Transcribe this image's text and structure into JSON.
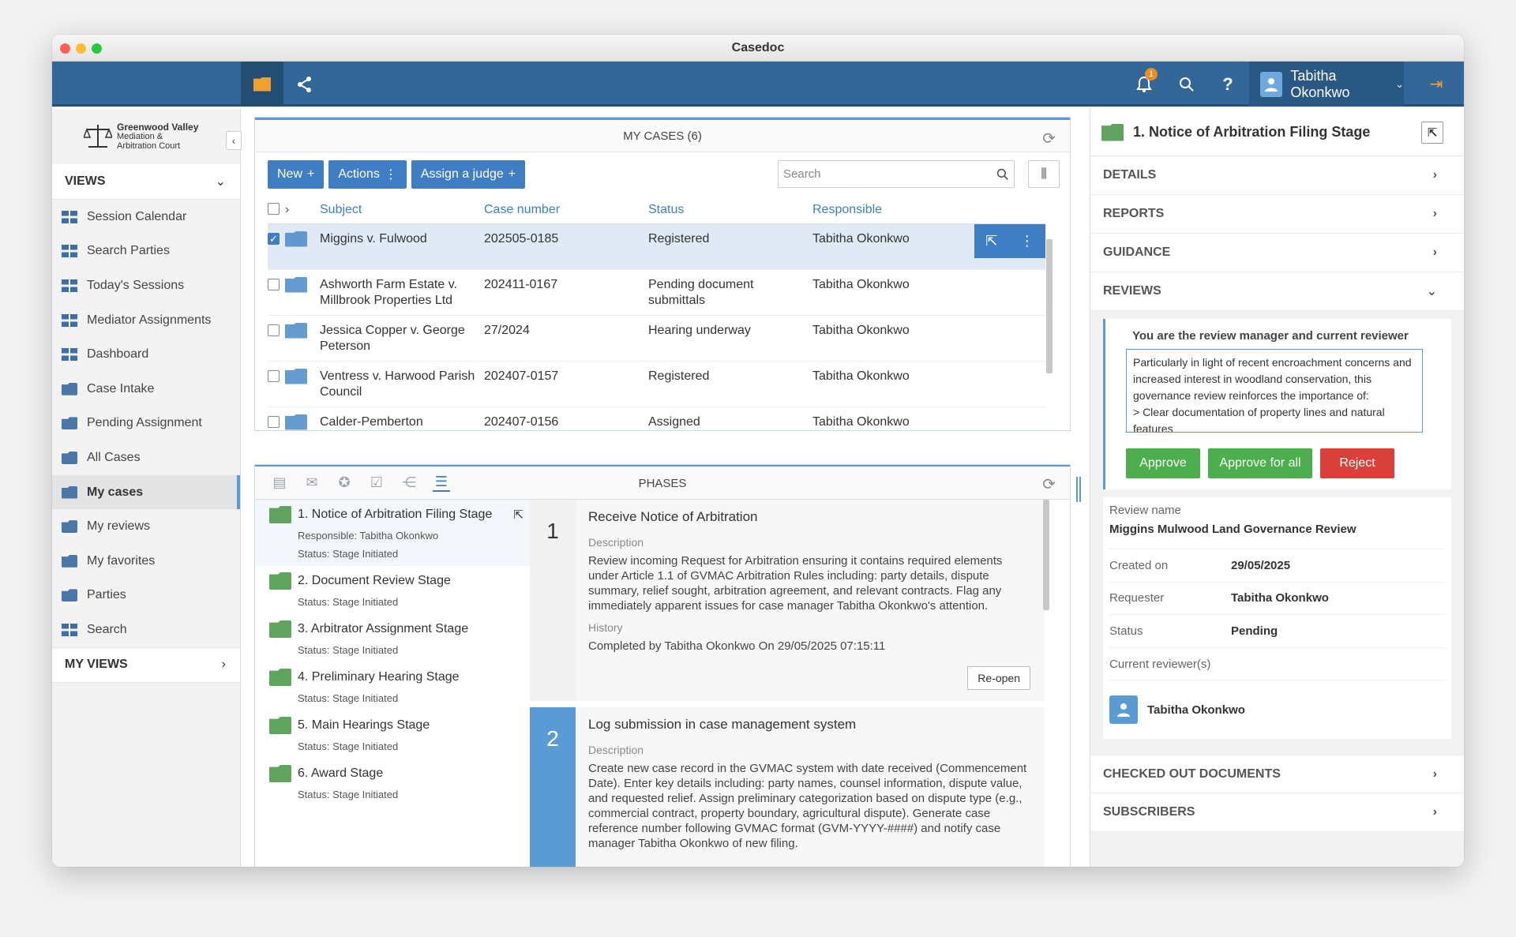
{
  "window": {
    "title": "Casedoc"
  },
  "topnav": {
    "notifications_count": "1",
    "user_name": "Tabitha Okonkwo"
  },
  "sidebar": {
    "logo": {
      "line1": "Greenwood Valley",
      "line2": "Mediation &",
      "line3": "Arbitration Court"
    },
    "views_label": "VIEWS",
    "items": [
      {
        "label": "Session Calendar",
        "icon": "grid-icon"
      },
      {
        "label": "Search Parties",
        "icon": "grid-icon"
      },
      {
        "label": "Today's Sessions",
        "icon": "grid-icon"
      },
      {
        "label": "Mediator Assignments",
        "icon": "grid-icon"
      },
      {
        "label": "Dashboard",
        "icon": "grid-icon"
      },
      {
        "label": "Case Intake",
        "icon": "folder-icon"
      },
      {
        "label": "Pending Assignment",
        "icon": "folder-icon"
      },
      {
        "label": "All Cases",
        "icon": "folder-icon"
      },
      {
        "label": "My cases",
        "icon": "user-folder-icon"
      },
      {
        "label": "My reviews",
        "icon": "user-icon"
      },
      {
        "label": "My favorites",
        "icon": "flag-icon"
      },
      {
        "label": "Parties",
        "icon": "parties-icon"
      },
      {
        "label": "Search",
        "icon": "grid-icon"
      }
    ],
    "my_views_label": "MY VIEWS"
  },
  "cases": {
    "title": "MY CASES (6)",
    "toolbar": {
      "new": "New",
      "actions": "Actions",
      "assign_judge": "Assign a judge"
    },
    "search_placeholder": "Search",
    "columns": {
      "subject": "Subject",
      "case_number": "Case number",
      "status": "Status",
      "responsible": "Responsible"
    },
    "rows": [
      {
        "subject": "Miggins v. Fulwood",
        "case_number": "202505-0185",
        "status": "Registered",
        "responsible": "Tabitha Okonkwo"
      },
      {
        "subject": "Ashworth Farm Estate v. Millbrook Properties Ltd",
        "case_number": "202411-0167",
        "status": "Pending document submittals",
        "responsible": "Tabitha Okonkwo"
      },
      {
        "subject": "Jessica Copper v. George Peterson",
        "case_number": "27/2024",
        "status": "Hearing underway",
        "responsible": "Tabitha Okonkwo"
      },
      {
        "subject": "Ventress v. Harwood Parish Council",
        "case_number": "202407-0157",
        "status": "Registered",
        "responsible": "Tabitha Okonkwo"
      },
      {
        "subject": "Calder-Pemberton",
        "case_number": "202407-0156",
        "status": "Assigned",
        "responsible": "Tabitha Okonkwo"
      }
    ]
  },
  "phases": {
    "title": "PHASES",
    "stages": [
      {
        "name": "1. Notice of Arbitration Filing Stage",
        "responsible": "Responsible: Tabitha Okonkwo",
        "status": "Status: Stage Initiated"
      },
      {
        "name": "2. Document Review Stage",
        "status": "Status: Stage Initiated"
      },
      {
        "name": "3. Arbitrator Assignment Stage",
        "status": "Status: Stage Initiated"
      },
      {
        "name": "4. Preliminary Hearing Stage",
        "status": "Status: Stage Initiated"
      },
      {
        "name": "5. Main Hearings Stage",
        "status": "Status: Stage Initiated"
      },
      {
        "name": "6. Award Stage",
        "status": "Status: Stage Initiated"
      }
    ],
    "tasks": [
      {
        "num": "1",
        "title": "Receive Notice of Arbitration",
        "desc_label": "Description",
        "desc": "Review incoming Request for Arbitration ensuring it contains required elements under Article 1.1 of GVMAC Arbitration Rules including: party details, dispute summary, relief sought, arbitration agreement, and relevant contracts. Flag any immediately apparent issues for case manager Tabitha Okonkwo's attention.",
        "history_label": "History",
        "history": "Completed by Tabitha Okonkwo On 29/05/2025 07:15:11",
        "reopen": "Re-open"
      },
      {
        "num": "2",
        "title": "Log submission in case management system",
        "desc_label": "Description",
        "desc": "Create new case record in the GVMAC system with date received (Commencement Date). Enter key details including: party names, counsel information, dispute value, and requested relief. Assign preliminary categorization based on dispute type (e.g., commercial contract, property boundary, agricultural dispute). Generate case reference number following GVMAC format (GVM-YYYY-####) and notify case manager Tabitha Okonkwo of new filing."
      }
    ]
  },
  "details": {
    "title": "1. Notice of Arbitration Filing Stage",
    "sections": {
      "details": "DETAILS",
      "reports": "REPORTS",
      "guidance": "GUIDANCE",
      "reviews": "REVIEWS",
      "checked_out": "CHECKED OUT DOCUMENTS",
      "subscribers": "SUBSCRIBERS"
    },
    "review": {
      "heading": "You are the review manager and current reviewer",
      "comment": "Particularly in light of recent encroachment concerns and increased interest in woodland conservation, this governance review reinforces the importance of:\n> Clear documentation of property lines and natural features",
      "approve": "Approve",
      "approve_all": "Approve for all",
      "reject": "Reject",
      "name_label": "Review name",
      "name": "Miggins Mulwood Land Governance Review",
      "created_label": "Created on",
      "created": "29/05/2025",
      "requester_label": "Requester",
      "requester": "Tabitha Okonkwo",
      "status_label": "Status",
      "status": "Pending",
      "reviewers_label": "Current reviewer(s)",
      "reviewer": "Tabitha Okonkwo"
    }
  },
  "colors": {
    "primary": "#336699",
    "accent": "#3f7ec2",
    "approve": "#4cae4c",
    "reject": "#d9403a"
  }
}
